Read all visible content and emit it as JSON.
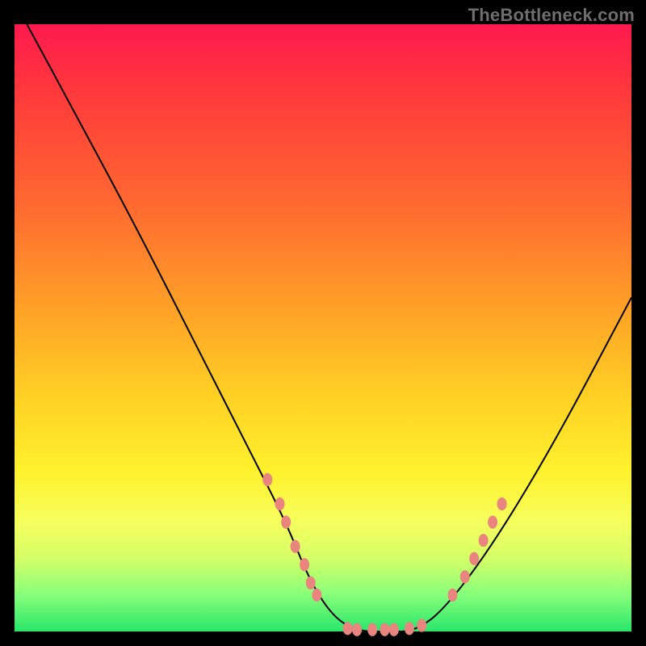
{
  "watermark": "TheBottleneck.com",
  "chart_data": {
    "type": "line",
    "title": "",
    "xlabel": "",
    "ylabel": "",
    "xlim": [
      0,
      100
    ],
    "ylim": [
      0,
      100
    ],
    "grid": false,
    "legend": null,
    "series": [
      {
        "name": "bottleneck-curve",
        "x": [
          2,
          10,
          20,
          30,
          38,
          44,
          48,
          52,
          56,
          60,
          65,
          70,
          78,
          88,
          100
        ],
        "y": [
          100,
          85,
          66,
          46,
          30,
          18,
          8,
          2,
          0,
          0,
          0,
          4,
          15,
          32,
          55
        ]
      }
    ],
    "markers": {
      "left_cluster": [
        {
          "x": 41,
          "y": 25
        },
        {
          "x": 43,
          "y": 21
        },
        {
          "x": 44,
          "y": 18
        },
        {
          "x": 45.5,
          "y": 14
        },
        {
          "x": 47,
          "y": 11
        },
        {
          "x": 48,
          "y": 8
        },
        {
          "x": 49,
          "y": 6
        }
      ],
      "bottom_cluster": [
        {
          "x": 54,
          "y": 0.5
        },
        {
          "x": 55.5,
          "y": 0.3
        },
        {
          "x": 58,
          "y": 0.3
        },
        {
          "x": 60,
          "y": 0.3
        },
        {
          "x": 61.5,
          "y": 0.3
        },
        {
          "x": 64,
          "y": 0.5
        },
        {
          "x": 66,
          "y": 1
        }
      ],
      "right_cluster": [
        {
          "x": 71,
          "y": 6
        },
        {
          "x": 73,
          "y": 9
        },
        {
          "x": 74.5,
          "y": 12
        },
        {
          "x": 76,
          "y": 15
        },
        {
          "x": 77.5,
          "y": 18
        },
        {
          "x": 79,
          "y": 21
        }
      ]
    },
    "gradient_colors": [
      "#ff1a4d",
      "#ff6a30",
      "#ffd324",
      "#fff22e",
      "#86ff7a",
      "#29e66a"
    ]
  }
}
